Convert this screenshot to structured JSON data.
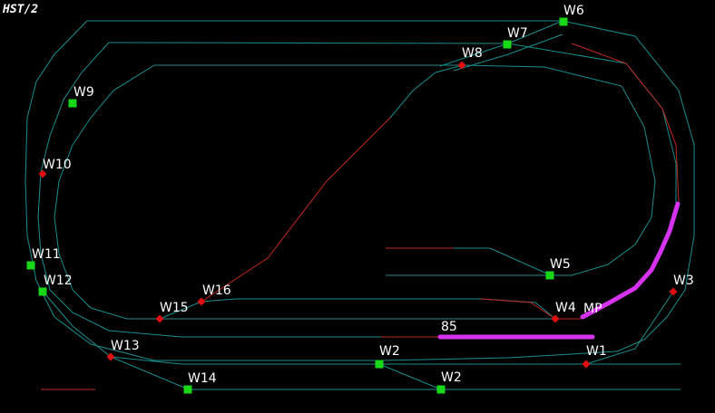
{
  "window": {
    "title": "HST/2"
  },
  "colors": {
    "background": "#000000",
    "track": "#1a8e8e",
    "track_red": "#c4281c",
    "occupied": "#d633f0",
    "switch_green": "#18d818",
    "switch_red": "#e01010",
    "label": "#ffffff"
  },
  "switches": {
    "w1": {
      "label": "W1",
      "state": "red"
    },
    "w2a": {
      "label": "W2",
      "state": "green"
    },
    "w2b": {
      "label": "W2",
      "state": "green"
    },
    "w3": {
      "label": "W3",
      "state": "red"
    },
    "w4": {
      "label": "W4",
      "state": "red"
    },
    "w5": {
      "label": "W5",
      "state": "green"
    },
    "w6": {
      "label": "W6",
      "state": "green"
    },
    "w7": {
      "label": "W7",
      "state": "green"
    },
    "w8": {
      "label": "W8",
      "state": "red"
    },
    "w9": {
      "label": "W9",
      "state": "green"
    },
    "w10": {
      "label": "W10",
      "state": "red"
    },
    "w11": {
      "label": "W11",
      "state": "green"
    },
    "w12": {
      "label": "W12",
      "state": "green"
    },
    "w13": {
      "label": "W13",
      "state": "red"
    },
    "w14": {
      "label": "W14",
      "state": "green"
    },
    "w15": {
      "label": "W15",
      "state": "red"
    },
    "w16": {
      "label": "W16",
      "state": "red"
    }
  },
  "labels": {
    "mp": "MP",
    "train_85": "85"
  }
}
